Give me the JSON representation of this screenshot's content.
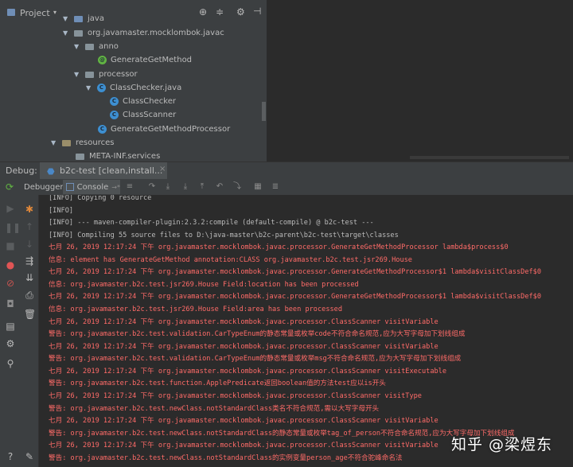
{
  "project_panel": {
    "title": "Project",
    "tree": [
      {
        "label": "java",
        "kind": "folder",
        "expanded": true
      },
      {
        "label": "org.javamaster.mocklombok.javac",
        "kind": "folder",
        "expanded": true
      },
      {
        "label": "anno",
        "kind": "folder",
        "expanded": true
      },
      {
        "label": "GenerateGetMethod",
        "kind": "annotation"
      },
      {
        "label": "processor",
        "kind": "folder",
        "expanded": true
      },
      {
        "label": "ClassChecker.java",
        "kind": "class-file",
        "expanded": true
      },
      {
        "label": "ClassChecker",
        "kind": "class"
      },
      {
        "label": "ClassScanner",
        "kind": "class"
      },
      {
        "label": "GenerateGetMethodProcessor",
        "kind": "class"
      },
      {
        "label": "resources",
        "kind": "folder",
        "expanded": true
      },
      {
        "label": "META-INF.services",
        "kind": "folder",
        "expanded": false
      }
    ]
  },
  "debug_bar": {
    "label": "Debug:",
    "run_tab": "b2c-test [clean,install..."
  },
  "debug_tabs": {
    "debugger": "Debugger",
    "console": "Console"
  },
  "console_lines": [
    {
      "text": "[INFO] Copying 0 resource",
      "level": "info"
    },
    {
      "text": "[INFO]",
      "level": "info"
    },
    {
      "text": "[INFO] --- maven-compiler-plugin:2.3.2:compile (default-compile) @ b2c-test ---",
      "level": "info"
    },
    {
      "text": "[INFO] Compiling 55 source files to D:\\java-master\\b2c-parent\\b2c-test\\target\\classes",
      "level": "info"
    },
    {
      "text": "七月 26, 2019 12:17:24 下午 org.javamaster.mocklombok.javac.processor.GenerateGetMethodProcessor lambda$process$0",
      "level": "warn"
    },
    {
      "text": "信息: element has GenerateGetMethod annotation:CLASS org.javamaster.b2c.test.jsr269.House",
      "level": "warn"
    },
    {
      "text": "七月 26, 2019 12:17:24 下午 org.javamaster.mocklombok.javac.processor.GenerateGetMethodProcessor$1 lambda$visitClassDef$0",
      "level": "warn"
    },
    {
      "text": "信息: org.javamaster.b2c.test.jsr269.House Field:location has been processed",
      "level": "warn"
    },
    {
      "text": "七月 26, 2019 12:17:24 下午 org.javamaster.mocklombok.javac.processor.GenerateGetMethodProcessor$1 lambda$visitClassDef$0",
      "level": "warn"
    },
    {
      "text": "信息: org.javamaster.b2c.test.jsr269.House Field:area has been processed",
      "level": "warn"
    },
    {
      "text": "七月 26, 2019 12:17:24 下午 org.javamaster.mocklombok.javac.processor.ClassScanner visitVariable",
      "level": "warn"
    },
    {
      "text": "警告: org.javamaster.b2c.test.validation.CarTypeEnum的静态常量或枚举code不符合命名规范,应为大写字母加下划线组成",
      "level": "warn"
    },
    {
      "text": "七月 26, 2019 12:17:24 下午 org.javamaster.mocklombok.javac.processor.ClassScanner visitVariable",
      "level": "warn"
    },
    {
      "text": "警告: org.javamaster.b2c.test.validation.CarTypeEnum的静态常量或枚举msg不符合命名规范,应为大写字母加下划线组成",
      "level": "warn"
    },
    {
      "text": "七月 26, 2019 12:17:24 下午 org.javamaster.mocklombok.javac.processor.ClassScanner visitExecutable",
      "level": "warn"
    },
    {
      "text": "警告: org.javamaster.b2c.test.function.ApplePredicate返回boolean值的方法test应以is开头",
      "level": "warn"
    },
    {
      "text": "七月 26, 2019 12:17:24 下午 org.javamaster.mocklombok.javac.processor.ClassScanner visitType",
      "level": "warn"
    },
    {
      "text": "警告: org.javamaster.b2c.test.newClass.notStandardClass类名不符合规范,需以大写字母开头",
      "level": "warn"
    },
    {
      "text": "七月 26, 2019 12:17:24 下午 org.javamaster.mocklombok.javac.processor.ClassScanner visitVariable",
      "level": "warn"
    },
    {
      "text": "警告: org.javamaster.b2c.test.newClass.notStandardClass的静态常量或枚举tag_of_person不符合命名规范,应为大写字母加下划线组成",
      "level": "warn"
    },
    {
      "text": "七月 26, 2019 12:17:24 下午 org.javamaster.mocklombok.javac.processor.ClassScanner visitVariable",
      "level": "warn"
    },
    {
      "text": "警告: org.javamaster.b2c.test.newClass.notStandardClass的实例变量person_age不符合驼峰命名法",
      "level": "warn"
    }
  ],
  "watermark": "知乎 @梁煜东",
  "colors": {
    "panel": "#3c3f41",
    "editor": "#2b2b2b",
    "info_text": "#bbbbbb",
    "warn_text": "#ff6b68",
    "accent": "#4a88c7"
  }
}
